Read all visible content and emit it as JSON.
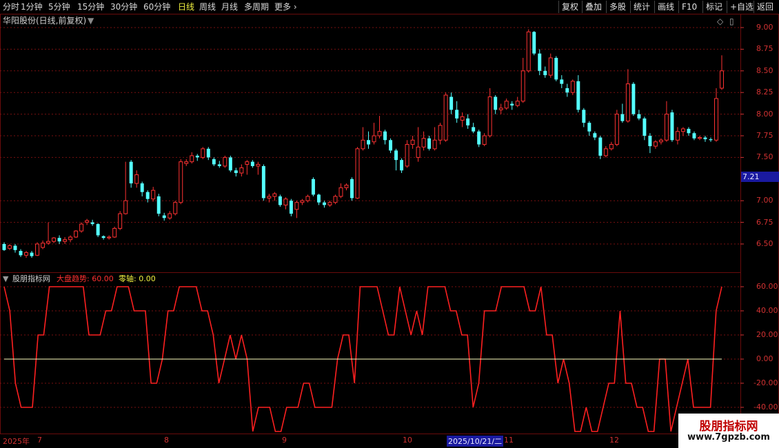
{
  "toolbar": {
    "periods": [
      "分时",
      "1分钟",
      "5分钟",
      "15分钟",
      "30分钟",
      "60分钟",
      "日线",
      "周线",
      "月线",
      "多周期",
      "更多"
    ],
    "active_period": "日线",
    "right_buttons": [
      "复权",
      "叠加",
      "多股",
      "统计",
      "画线",
      "F10",
      "标记",
      "+自选",
      "返回"
    ]
  },
  "chart_title": "华阳股份(日线,前复权)",
  "indicator": {
    "name": "股朋指标网",
    "line1": "大盘趋势: 60.00",
    "line2": "零轴: 0.00"
  },
  "price_axis": [
    "9.00",
    "8.75",
    "8.50",
    "8.25",
    "8.00",
    "7.75",
    "7.50",
    "7.00",
    "6.75",
    "6.50"
  ],
  "price_marker": "7.21",
  "indicator_axis": [
    "60.00",
    "40.00",
    "20.00",
    "0.00",
    "-20.00",
    "-40.00"
  ],
  "date_axis": [
    "2025年",
    "7",
    "8",
    "9",
    "10",
    "11",
    "12"
  ],
  "date_cursor": "2025/10/21/二",
  "watermark": {
    "line1": "股朋指标网",
    "line2": "www.7gpzb.com"
  },
  "colors": {
    "up": "#ff3232",
    "down": "#54ffff",
    "indicator_line": "#ff2020",
    "zero_line": "#ffffc0",
    "axis": "#d23232",
    "marker_bg": "#1a1aa0",
    "cursor_bg": "#1a1aa0"
  },
  "chart_data": {
    "type": "candlestick",
    "title": "华阳股份(日线,前复权)",
    "ylim": [
      6.3,
      9.1
    ],
    "candles": [
      [
        6.5,
        6.43,
        6.52,
        6.42
      ],
      [
        6.45,
        6.48,
        6.5,
        6.43
      ],
      [
        6.48,
        6.43,
        6.5,
        6.4
      ],
      [
        6.42,
        6.37,
        6.44,
        6.35
      ],
      [
        6.37,
        6.4,
        6.42,
        6.34
      ],
      [
        6.4,
        6.36,
        6.42,
        6.34
      ],
      [
        6.37,
        6.5,
        6.52,
        6.36
      ],
      [
        6.46,
        6.51,
        6.54,
        6.44
      ],
      [
        6.51,
        6.53,
        6.75,
        6.49
      ],
      [
        6.53,
        6.57,
        6.58,
        6.51
      ],
      [
        6.57,
        6.53,
        6.6,
        6.5
      ],
      [
        6.53,
        6.55,
        6.58,
        6.5
      ],
      [
        6.55,
        6.58,
        6.6,
        6.52
      ],
      [
        6.58,
        6.65,
        6.66,
        6.57
      ],
      [
        6.65,
        6.73,
        6.75,
        6.63
      ],
      [
        6.75,
        6.77,
        6.79,
        6.72
      ],
      [
        6.75,
        6.73,
        6.78,
        6.71
      ],
      [
        6.73,
        6.6,
        6.74,
        6.58
      ],
      [
        6.59,
        6.57,
        6.6,
        6.55
      ],
      [
        6.57,
        6.58,
        6.6,
        6.55
      ],
      [
        6.58,
        6.68,
        6.7,
        6.57
      ],
      [
        6.68,
        6.85,
        6.88,
        6.66
      ],
      [
        6.85,
        7.0,
        7.45,
        6.84
      ],
      [
        7.45,
        7.2,
        7.47,
        7.15
      ],
      [
        7.2,
        7.3,
        7.35,
        7.15
      ],
      [
        7.2,
        7.1,
        7.22,
        7.05
      ],
      [
        7.1,
        7.02,
        7.12,
        6.98
      ],
      [
        7.02,
        7.12,
        7.16,
        6.99
      ],
      [
        7.05,
        6.85,
        7.08,
        6.82
      ],
      [
        6.83,
        6.8,
        6.86,
        6.77
      ],
      [
        6.8,
        6.85,
        6.88,
        6.78
      ],
      [
        6.85,
        6.98,
        7.0,
        6.83
      ],
      [
        6.98,
        7.45,
        7.48,
        6.96
      ],
      [
        7.43,
        7.45,
        7.48,
        7.4
      ],
      [
        7.45,
        7.52,
        7.56,
        7.43
      ],
      [
        7.52,
        7.5,
        7.54,
        7.46
      ],
      [
        7.5,
        7.6,
        7.62,
        7.48
      ],
      [
        7.6,
        7.5,
        7.62,
        7.47
      ],
      [
        7.48,
        7.42,
        7.5,
        7.4
      ],
      [
        7.42,
        7.4,
        7.46,
        7.38
      ],
      [
        7.4,
        7.5,
        7.52,
        7.38
      ],
      [
        7.5,
        7.35,
        7.52,
        7.33
      ],
      [
        7.35,
        7.32,
        7.38,
        7.28
      ],
      [
        7.32,
        7.38,
        7.42,
        7.28
      ],
      [
        7.42,
        7.45,
        7.47,
        7.3
      ],
      [
        7.45,
        7.4,
        7.47,
        7.38
      ],
      [
        7.4,
        7.42,
        7.45,
        7.3
      ],
      [
        7.4,
        7.03,
        7.42,
        7.0
      ],
      [
        7.03,
        7.05,
        7.08,
        6.98
      ],
      [
        7.05,
        7.08,
        7.1,
        7.0
      ],
      [
        7.05,
        6.95,
        7.07,
        6.93
      ],
      [
        6.95,
        7.02,
        7.04,
        6.9
      ],
      [
        7.0,
        6.85,
        7.02,
        6.82
      ],
      [
        6.9,
        6.98,
        7.0,
        6.8
      ],
      [
        6.98,
        7.0,
        7.02,
        6.95
      ],
      [
        7.0,
        7.05,
        7.07,
        6.98
      ],
      [
        7.25,
        7.07,
        7.27,
        7.05
      ],
      [
        7.07,
        6.98,
        7.08,
        6.95
      ],
      [
        6.98,
        6.95,
        7.0,
        6.92
      ],
      [
        6.95,
        6.98,
        7.0,
        6.93
      ],
      [
        6.98,
        7.05,
        7.07,
        6.96
      ],
      [
        7.05,
        7.15,
        7.2,
        7.03
      ],
      [
        7.15,
        7.18,
        7.2,
        7.12
      ],
      [
        7.25,
        7.03,
        7.27,
        7.0
      ],
      [
        7.03,
        7.6,
        7.62,
        7.02
      ],
      [
        7.6,
        7.7,
        7.85,
        7.58
      ],
      [
        7.7,
        7.65,
        7.8,
        7.6
      ],
      [
        7.68,
        7.75,
        7.9,
        7.65
      ],
      [
        7.75,
        7.8,
        7.98,
        7.72
      ],
      [
        7.8,
        7.7,
        7.82,
        7.65
      ],
      [
        7.7,
        7.58,
        7.72,
        7.55
      ],
      [
        7.58,
        7.47,
        7.6,
        7.35
      ],
      [
        7.47,
        7.35,
        7.49,
        7.32
      ],
      [
        7.4,
        7.65,
        7.7,
        7.38
      ],
      [
        7.65,
        7.7,
        7.75,
        7.6
      ],
      [
        7.5,
        7.62,
        7.85,
        7.45
      ],
      [
        7.62,
        7.72,
        7.8,
        7.58
      ],
      [
        7.72,
        7.6,
        7.75,
        7.58
      ],
      [
        7.6,
        7.7,
        7.85,
        7.58
      ],
      [
        7.7,
        7.87,
        7.9,
        7.65
      ],
      [
        7.7,
        8.22,
        8.25,
        7.68
      ],
      [
        8.2,
        8.05,
        8.25,
        8.0
      ],
      [
        8.05,
        7.95,
        8.15,
        7.9
      ],
      [
        7.93,
        7.97,
        8.02,
        7.85
      ],
      [
        7.95,
        7.87,
        8.0,
        7.83
      ],
      [
        7.85,
        7.8,
        7.9,
        7.78
      ],
      [
        7.8,
        7.65,
        7.82,
        7.62
      ],
      [
        7.65,
        7.75,
        7.78,
        7.63
      ],
      [
        7.75,
        8.2,
        8.3,
        7.73
      ],
      [
        8.2,
        8.05,
        8.22,
        8.0
      ],
      [
        8.05,
        8.07,
        8.12,
        8.0
      ],
      [
        8.07,
        8.15,
        8.18,
        8.05
      ],
      [
        8.12,
        8.1,
        8.15,
        8.05
      ],
      [
        8.1,
        8.15,
        8.2,
        8.08
      ],
      [
        8.15,
        8.5,
        8.65,
        8.13
      ],
      [
        8.5,
        8.95,
        8.98,
        8.48
      ],
      [
        8.95,
        8.7,
        8.96,
        8.68
      ],
      [
        8.7,
        8.5,
        8.75,
        8.45
      ],
      [
        8.5,
        8.45,
        8.55,
        8.42
      ],
      [
        8.45,
        8.65,
        8.7,
        8.42
      ],
      [
        8.65,
        8.4,
        8.67,
        8.38
      ],
      [
        8.4,
        8.35,
        8.45,
        8.3
      ],
      [
        8.3,
        8.25,
        8.35,
        8.2
      ],
      [
        8.25,
        8.38,
        8.4,
        8.22
      ],
      [
        8.38,
        8.05,
        8.45,
        8.02
      ],
      [
        8.05,
        7.9,
        8.07,
        7.85
      ],
      [
        7.9,
        7.8,
        7.92,
        7.75
      ],
      [
        7.78,
        7.73,
        7.8,
        7.7
      ],
      [
        7.73,
        7.52,
        7.75,
        7.48
      ],
      [
        7.52,
        7.6,
        7.63,
        7.5
      ],
      [
        7.6,
        7.65,
        7.68,
        7.58
      ],
      [
        7.65,
        8.0,
        8.05,
        7.63
      ],
      [
        8.0,
        7.92,
        8.12,
        7.9
      ],
      [
        7.92,
        8.35,
        8.52,
        7.9
      ],
      [
        8.35,
        8.0,
        8.37,
        7.98
      ],
      [
        8.0,
        7.95,
        8.05,
        7.93
      ],
      [
        7.95,
        7.75,
        7.97,
        7.7
      ],
      [
        7.75,
        7.63,
        7.78,
        7.55
      ],
      [
        7.63,
        7.68,
        7.7,
        7.6
      ],
      [
        7.68,
        7.7,
        7.72,
        7.65
      ],
      [
        7.7,
        8.0,
        8.15,
        7.68
      ],
      [
        8.02,
        7.7,
        8.05,
        7.68
      ],
      [
        7.7,
        7.8,
        7.85,
        7.65
      ],
      [
        7.8,
        7.83,
        7.85,
        7.75
      ],
      [
        7.83,
        7.78,
        7.85,
        7.75
      ],
      [
        7.78,
        7.72,
        7.8,
        7.7
      ],
      [
        7.72,
        7.73,
        7.75,
        7.7
      ],
      [
        7.73,
        7.71,
        7.75,
        7.68
      ],
      [
        7.71,
        7.7,
        7.73,
        7.68
      ],
      [
        7.7,
        8.18,
        8.3,
        7.68
      ],
      [
        8.3,
        8.5,
        8.68,
        8.28
      ]
    ],
    "series": [
      {
        "name": "大盘趋势",
        "ylim": [
          -60,
          65
        ],
        "values": [
          60,
          40,
          -20,
          -40,
          -40,
          -40,
          20,
          20,
          60,
          60,
          60,
          60,
          60,
          60,
          60,
          20,
          20,
          20,
          40,
          40,
          60,
          60,
          60,
          40,
          40,
          40,
          -20,
          -20,
          0,
          40,
          40,
          60,
          60,
          60,
          60,
          40,
          40,
          20,
          -20,
          0,
          20,
          0,
          20,
          0,
          -60,
          -40,
          -40,
          -40,
          -60,
          -60,
          -40,
          -40,
          -40,
          -20,
          -20,
          -40,
          -40,
          -40,
          -40,
          0,
          20,
          20,
          -20,
          60,
          60,
          60,
          60,
          40,
          20,
          20,
          60,
          40,
          20,
          40,
          20,
          60,
          60,
          60,
          60,
          40,
          40,
          20,
          20,
          -40,
          -20,
          40,
          40,
          40,
          60,
          60,
          60,
          60,
          60,
          40,
          40,
          60,
          20,
          20,
          -20,
          0,
          -20,
          -60,
          -60,
          -40,
          -60,
          -60,
          -40,
          -20,
          -20,
          40,
          -20,
          -20,
          -40,
          -40,
          -60,
          -60,
          0,
          0,
          -60,
          -40,
          -20,
          0,
          -40,
          -40,
          -40,
          -40,
          40,
          60
        ]
      },
      {
        "name": "零轴",
        "values": [
          0
        ]
      }
    ]
  }
}
